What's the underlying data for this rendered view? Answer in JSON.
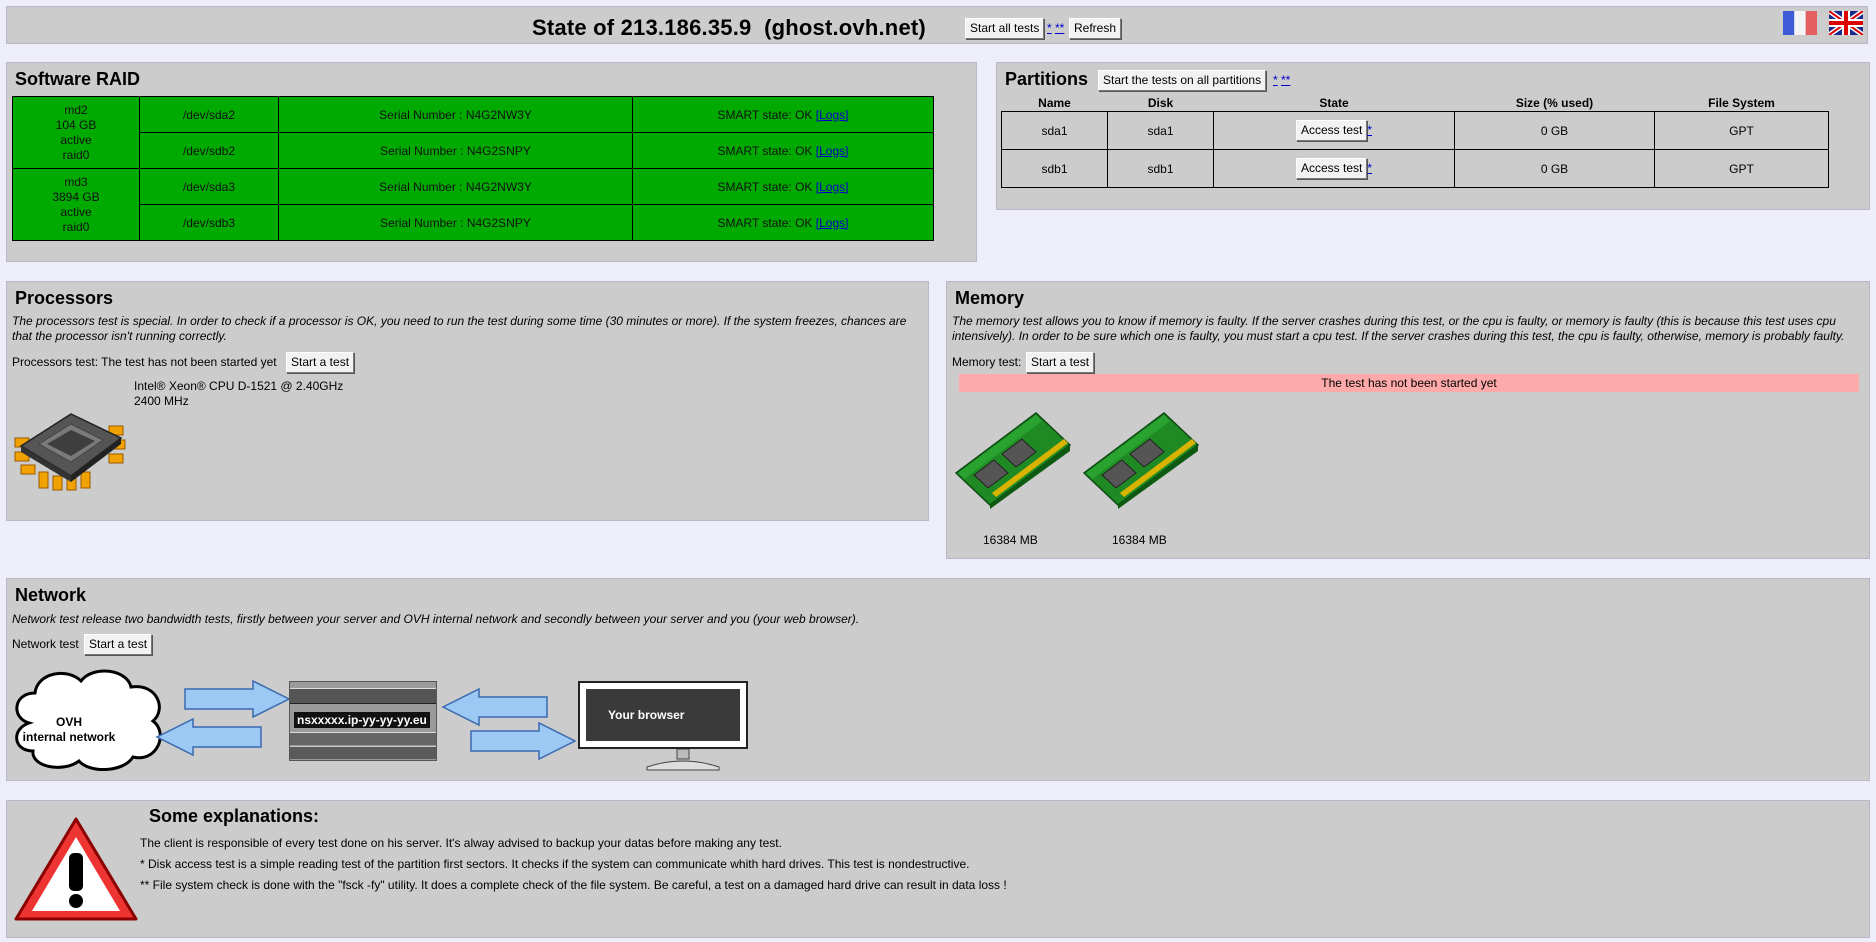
{
  "header": {
    "title": "State of 213.186.35.9  (ghost.ovh.net)",
    "start_all_label": "Start all tests",
    "star_links": [
      "*",
      "**"
    ],
    "refresh_label": "Refresh"
  },
  "raid": {
    "title": "Software RAID",
    "arrays": [
      {
        "name": "md2",
        "size": "104 GB",
        "status": "active",
        "level": "raid0",
        "disks": [
          {
            "dev": "/dev/sda2",
            "serial": "Serial Number : N4G2NW3Y",
            "smart": "SMART state: OK",
            "logs": "[Logs]"
          },
          {
            "dev": "/dev/sdb2",
            "serial": "Serial Number : N4G2SNPY",
            "smart": "SMART state: OK",
            "logs": "[Logs]"
          }
        ]
      },
      {
        "name": "md3",
        "size": "3894 GB",
        "status": "active",
        "level": "raid0",
        "disks": [
          {
            "dev": "/dev/sda3",
            "serial": "Serial Number : N4G2NW3Y",
            "smart": "SMART state: OK",
            "logs": "[Logs]"
          },
          {
            "dev": "/dev/sdb3",
            "serial": "Serial Number : N4G2SNPY",
            "smart": "SMART state: OK",
            "logs": "[Logs]"
          }
        ]
      }
    ]
  },
  "partitions": {
    "title": "Partitions",
    "start_label": "Start the tests on all partitions",
    "star_links": [
      "*",
      "**"
    ],
    "columns": [
      "Name",
      "Disk",
      "State",
      "Size (% used)",
      "File System"
    ],
    "rows": [
      {
        "name": "sda1",
        "disk": "sda1",
        "action": "Access test",
        "star": "*",
        "size": "0 GB",
        "fs": "GPT"
      },
      {
        "name": "sdb1",
        "disk": "sdb1",
        "action": "Access test",
        "star": "*",
        "size": "0 GB",
        "fs": "GPT"
      }
    ]
  },
  "processors": {
    "title": "Processors",
    "description": "The processors test is special. In order to check if a processor is OK, you need to run the test during some time (30 minutes or more). If the system freezes, chances are that the processor isn't running correctly.",
    "status_label": "Processors test: The test has not been started yet",
    "start_label": "Start a test",
    "cpu_model": "Intel® Xeon® CPU D-1521 @ 2.40GHz",
    "cpu_freq": "2400 MHz"
  },
  "memory": {
    "title": "Memory",
    "description": "The memory test allows you to know if memory is faulty. If the server crashes during this test, or the cpu is faulty, or memory is faulty (this is because this test uses cpu intensively). In order to be sure which one is faulty, you must start a cpu test. If the server crashes during this test, the cpu is faulty, otherwise, memory is probably faulty.",
    "test_label": "Memory test:",
    "start_label": "Start a test",
    "status": "The test has not been started yet",
    "modules": [
      "16384 MB",
      "16384 MB"
    ]
  },
  "network": {
    "title": "Network",
    "description": "Network test release two bandwidth tests, firstly between your server and OVH internal network and secondly between your server and you (your web browser).",
    "test_label": "Network test",
    "start_label": "Start a test",
    "cloud_line1": "OVH",
    "cloud_line2": "internal network",
    "server_label": "nsxxxxx.ip-yy-yy-yy.eu",
    "browser_label": "Your browser"
  },
  "explanations": {
    "title": "Some explanations:",
    "lines": [
      "The client is responsible of every test done on his server. It's alway advised to backup your datas before making any test.",
      "* Disk access test is a simple reading test of the partition first sectors. It checks if the system can communicate whith hard drives. This test is nondestructive.",
      "** File system check is done with the \"fsck -fy\" utility. It does a complete check of the file system. Be careful, a test on a damaged hard drive can result in data loss !"
    ]
  },
  "colors": {
    "raid_ok": "#00aa00",
    "panel": "#cccccc",
    "page": "#eeeefa",
    "status_bad": "#ffaaaa"
  }
}
